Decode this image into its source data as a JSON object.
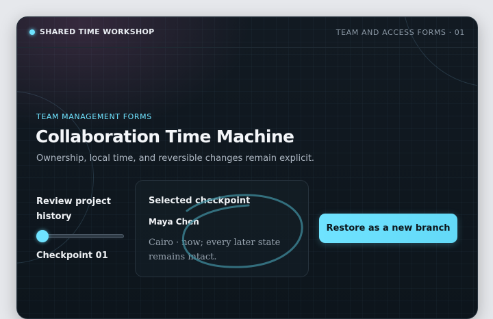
{
  "header": {
    "brand": "SHARED TIME WORKSHOP",
    "section": "TEAM AND ACCESS FORMS · 01"
  },
  "main": {
    "eyebrow": "TEAM MANAGEMENT FORMS",
    "title": "Collaboration Time Machine",
    "subtitle": "Ownership, local time, and reversible changes remain explicit."
  },
  "history": {
    "label": "Review project history",
    "slider_value": 0,
    "checkpoint_label": "Checkpoint 01"
  },
  "selected_checkpoint": {
    "heading": "Selected checkpoint",
    "name": "Maya Chen",
    "description": "Cairo · now; every later state remains intact."
  },
  "actions": {
    "restore_label": "Restore as a new branch"
  },
  "colors": {
    "accent": "#6fe3ff",
    "background": "#0d151c"
  }
}
